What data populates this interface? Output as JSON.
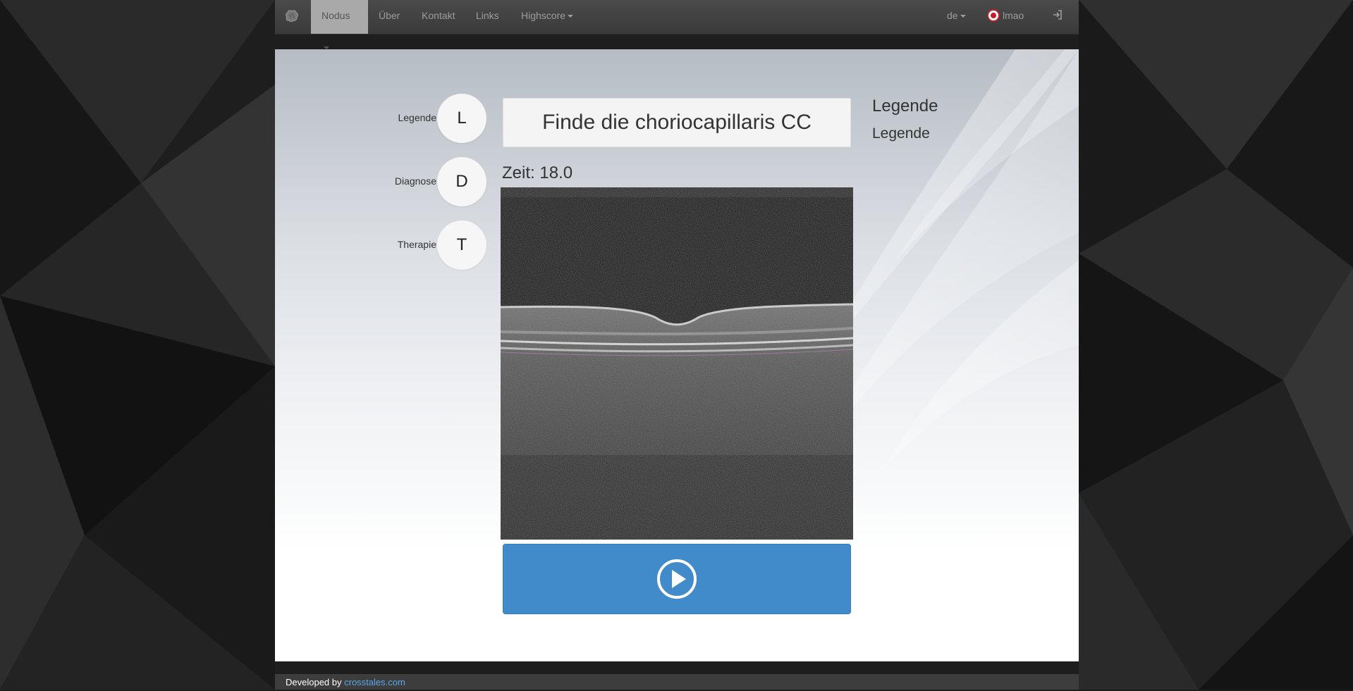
{
  "navbar": {
    "brand_icon": "brain-icon",
    "items": [
      {
        "label": "Nodus",
        "dropdown": true,
        "active": true
      },
      {
        "label": "Über",
        "dropdown": false,
        "active": false
      },
      {
        "label": "Kontakt",
        "dropdown": false,
        "active": false
      },
      {
        "label": "Links",
        "dropdown": false,
        "active": false
      },
      {
        "label": "Highscore",
        "dropdown": true,
        "active": false
      }
    ],
    "language": "de",
    "user": "lmao",
    "logout_icon": "sign-in-icon"
  },
  "sidebar": {
    "items": [
      {
        "label": "Legende",
        "letter": "L"
      },
      {
        "label": "Diagnose",
        "letter": "D"
      },
      {
        "label": "Therapie",
        "letter": "T"
      }
    ]
  },
  "task": {
    "prompt": "Finde die choriocapillaris CC",
    "timer": "Zeit: 18.0"
  },
  "legend": {
    "heading": "Legende",
    "subheading": "Legende"
  },
  "play_button": {
    "icon": "play-circle-icon"
  },
  "footer": {
    "text": "Developed by ",
    "link": "crosstales.com"
  },
  "colors": {
    "navbar_bg": "#3f3f3f",
    "active_nav": "#a9a9a9",
    "button_blue": "#428bca",
    "link_blue": "#5aa6e8"
  }
}
